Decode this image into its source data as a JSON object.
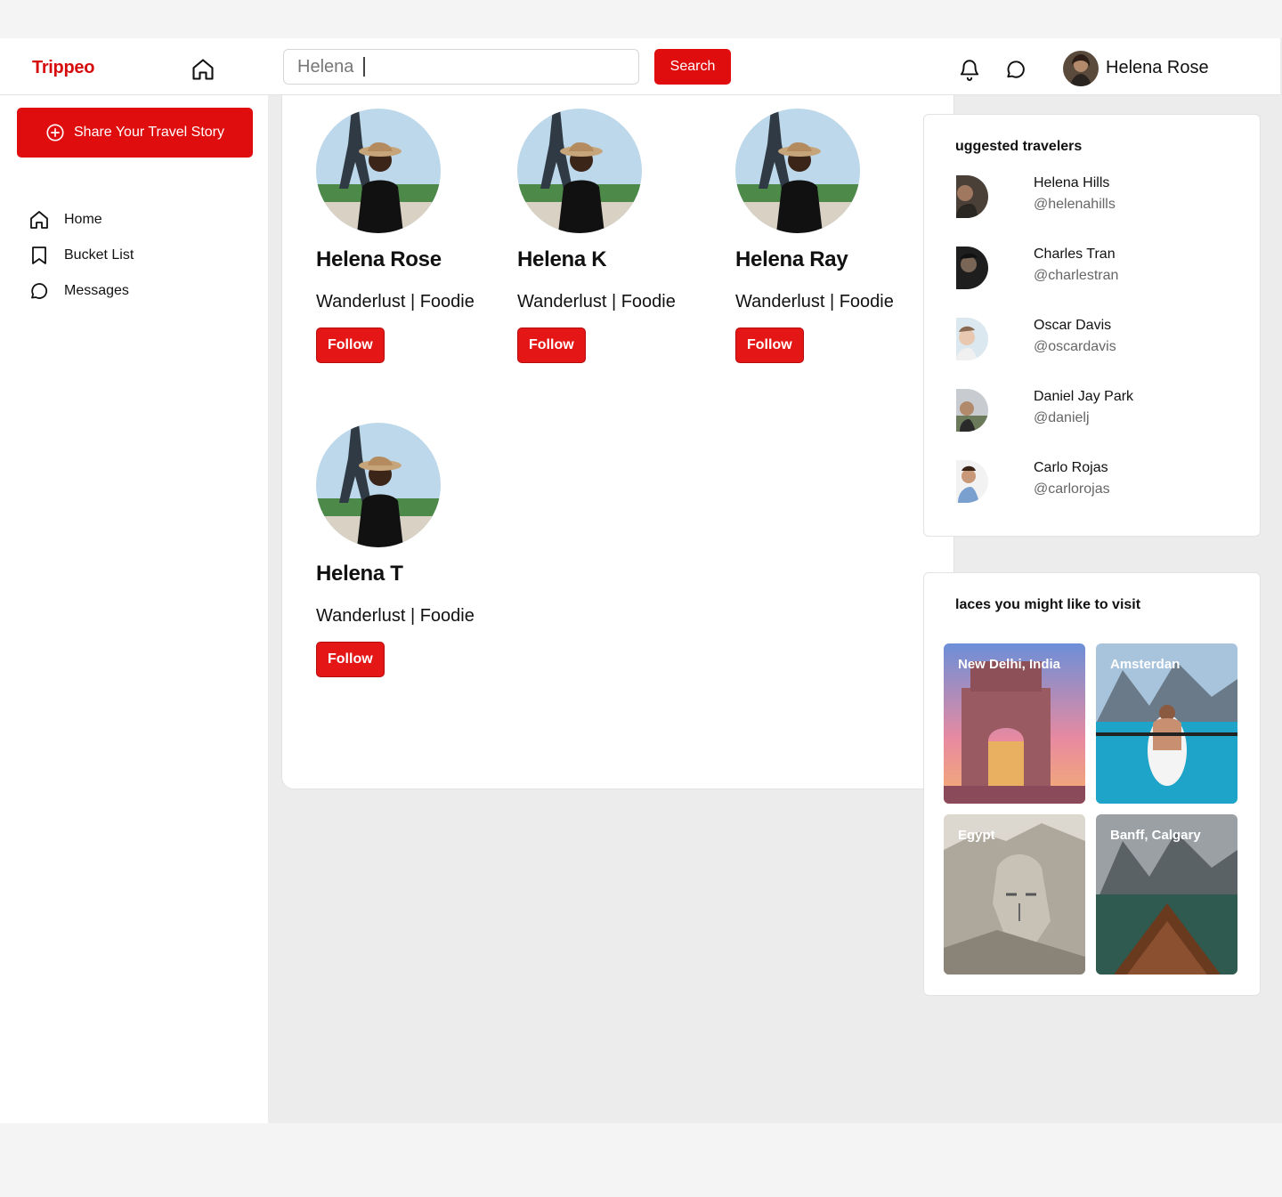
{
  "header": {
    "logo": "Trippeo",
    "search_value": "Helena",
    "search_button": "Search",
    "profile_name": "Helena Rose"
  },
  "sidebar": {
    "share_button": "Share Your Travel Story",
    "items": [
      {
        "label": "Home",
        "icon": "home-icon"
      },
      {
        "label": "Bucket List",
        "icon": "bookmark-icon"
      },
      {
        "label": "Messages",
        "icon": "message-icon"
      }
    ]
  },
  "results": [
    {
      "name": "Helena Rose",
      "tags": "Wanderlust | Foodie",
      "button": "Follow"
    },
    {
      "name": "Helena K",
      "tags": "Wanderlust | Foodie",
      "button": "Follow"
    },
    {
      "name": "Helena Ray",
      "tags": "Wanderlust | Foodie",
      "button": "Follow"
    },
    {
      "name": "Helena T",
      "tags": "Wanderlust | Foodie",
      "button": "Follow"
    }
  ],
  "suggested": {
    "title": "uggested travelers",
    "travelers": [
      {
        "name": "Helena Hills",
        "handle": "@helenahills"
      },
      {
        "name": "Charles Tran",
        "handle": "@charlestran"
      },
      {
        "name": "Oscar Davis",
        "handle": "@oscardavis"
      },
      {
        "name": "Daniel Jay Park",
        "handle": "@danielj"
      },
      {
        "name": "Carlo Rojas",
        "handle": "@carlorojas"
      }
    ]
  },
  "places": {
    "title": "laces you might like to visit",
    "items": [
      {
        "label": "New Delhi, India"
      },
      {
        "label": "Amsterdan"
      },
      {
        "label": "Egypt"
      },
      {
        "label": "Banff, Calgary"
      }
    ]
  },
  "colors": {
    "brand": "#df0d0d",
    "background": "#ececec"
  }
}
